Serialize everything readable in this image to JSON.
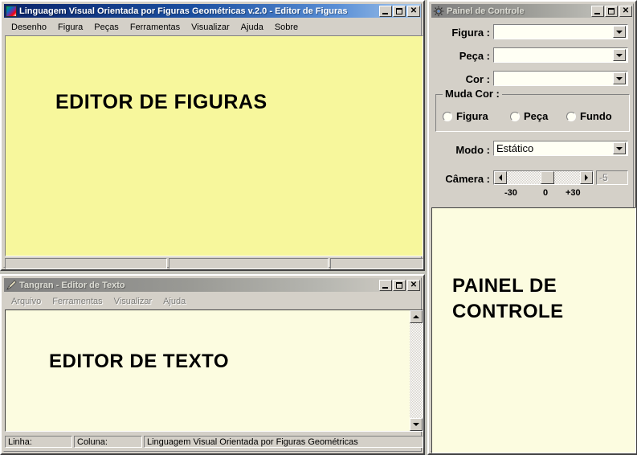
{
  "desktop": {
    "background_color": "#c3c3bb"
  },
  "editor_figuras": {
    "title": "Linguagem Visual Orientada por Figuras Geométricas v.2.0 - Editor de Figuras",
    "icon": "colorful-gradient-icon",
    "active": true,
    "window_buttons": {
      "minimize": "minimize-icon",
      "maximize": "maximize-icon",
      "close": "close-icon"
    },
    "menu": [
      {
        "label": "Desenho"
      },
      {
        "label": "Figura"
      },
      {
        "label": "Peças"
      },
      {
        "label": "Ferramentas"
      },
      {
        "label": "Visualizar"
      },
      {
        "label": "Ajuda"
      },
      {
        "label": "Sobre"
      }
    ],
    "canvas": {
      "label": "EDITOR DE FIGURAS",
      "color": "#f7f79c"
    },
    "status_panels": [
      {
        "text": ""
      },
      {
        "text": ""
      },
      {
        "text": ""
      }
    ]
  },
  "editor_texto": {
    "title": "Tangran - Editor de Texto",
    "icon": "pencil-icon",
    "active": false,
    "window_buttons": {
      "minimize": "minimize-icon",
      "maximize": "maximize-icon",
      "close": "close-icon"
    },
    "menu": [
      {
        "label": "Arquivo"
      },
      {
        "label": "Ferramentas"
      },
      {
        "label": "Visualizar"
      },
      {
        "label": "Ajuda"
      }
    ],
    "canvas": {
      "label": "EDITOR DE TEXTO",
      "color": "#fcfce0"
    },
    "scrollbar": {
      "up": "scroll-up-icon",
      "down": "scroll-down-icon"
    },
    "status_panels": [
      {
        "text": "Linha:"
      },
      {
        "text": "Coluna:"
      },
      {
        "text": "Linguagem Visual Orientada por Figuras Geométricas"
      }
    ]
  },
  "painel_controle": {
    "title": "Painel de Controle",
    "icon": "gear-icon",
    "active": false,
    "window_buttons": {
      "minimize": "minimize-icon",
      "maximize": "maximize-icon",
      "close": "close-icon"
    },
    "fields": [
      {
        "label": "Figura :",
        "value": "",
        "type": "combobox"
      },
      {
        "label": "Peça :",
        "value": "",
        "type": "combobox"
      },
      {
        "label": "Cor :",
        "value": "",
        "type": "combobox"
      }
    ],
    "muda_cor": {
      "title": "Muda Cor :",
      "options": [
        {
          "label": "Figura",
          "selected": false
        },
        {
          "label": "Peça",
          "selected": false
        },
        {
          "label": "Fundo",
          "selected": false
        }
      ]
    },
    "modo": {
      "label": "Modo :",
      "value": "Estático"
    },
    "camera": {
      "label": "Câmera :",
      "value": "-5",
      "ticks": [
        "-30",
        "0",
        "+30"
      ],
      "min": -30,
      "max": 30
    },
    "canvas": {
      "label_line1": "PAINEL DE",
      "label_line2": "CONTROLE",
      "color": "#fcfce0"
    }
  }
}
